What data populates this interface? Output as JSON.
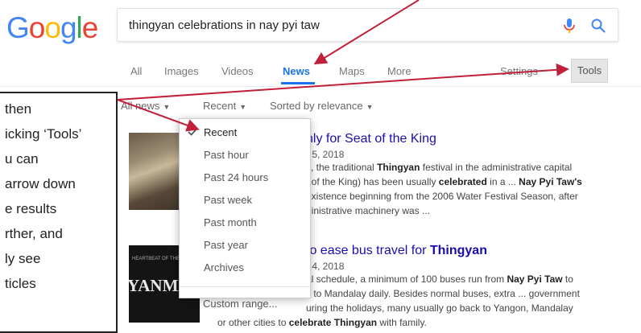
{
  "logo": {
    "letters": [
      "G",
      "o",
      "o",
      "g",
      "l",
      "e"
    ],
    "colors": [
      "#4285F4",
      "#EA4335",
      "#FBBC05",
      "#4285F4",
      "#34A853",
      "#EA4335"
    ]
  },
  "search": {
    "query": "thingyan celebrations in nay pyi taw",
    "icons": [
      "mic-icon",
      "search-icon"
    ]
  },
  "tabs": [
    {
      "label": "All",
      "active": false
    },
    {
      "label": "Images",
      "active": false
    },
    {
      "label": "Videos",
      "active": false
    },
    {
      "label": "News",
      "active": true
    },
    {
      "label": "Maps",
      "active": false
    },
    {
      "label": "More",
      "active": false
    },
    {
      "label": "Settings",
      "active": false
    },
    {
      "label": "Tools",
      "active": false
    }
  ],
  "filters": {
    "all_news": "All news",
    "recent": "Recent",
    "sort": "Sorted by relevance"
  },
  "dropdown": {
    "items": [
      "Recent",
      "Past hour",
      "Past 24 hours",
      "Past week",
      "Past month",
      "Past year",
      "Archives"
    ],
    "selected": "Recent",
    "custom": "Custom range..."
  },
  "results": [
    {
      "title": "nly for Seat of the King",
      "date": "r 5, 2018",
      "snippet": [
        [
          {
            "t": "s, the traditional "
          },
          {
            "t": "Thingyan",
            "b": true
          },
          {
            "t": " festival in the administrative capital"
          }
        ],
        [
          {
            "t": "t of the King) has been usually "
          },
          {
            "t": "celebrated",
            "b": true
          },
          {
            "t": " in a ... "
          },
          {
            "t": "Nay Pyi Taw's",
            "b": true
          }
        ],
        [
          {
            "t": "existence beginning from the 2006 Water Festival Season, after"
          }
        ],
        [
          {
            "t": "ninistrative machinery was ..."
          }
        ]
      ]
    },
    {
      "title_parts": [
        {
          "t": "to ease bus travel for "
        },
        {
          "t": "Thingyan",
          "b": true
        }
      ],
      "date": "r 4, 2018",
      "snippet": [
        [
          {
            "t": "al schedule, a minimum of 100 buses run from "
          },
          {
            "t": "Nay Pyi Taw",
            "b": true
          },
          {
            "t": " to"
          }
        ],
        [
          {
            "t": "s to Mandalay daily. Besides normal buses, extra ... government"
          }
        ],
        [
          {
            "t": "uring the holidays, many usually go back to Yangon, Mandalay"
          }
        ],
        [
          {
            "t": "or other cities to "
          },
          {
            "t": "celebrate Thingyan",
            "b": true
          },
          {
            "t": " with family."
          }
        ]
      ]
    }
  ],
  "thumbnail2": {
    "small_text": "HEARTBEAT OF THE NATION",
    "big_text": "YANMA"
  },
  "callout": {
    "lines": [
      "then",
      "icking ‘Tools’",
      "u can",
      "arrow down",
      "e results",
      "rther, and",
      "ly see",
      "ticles"
    ]
  },
  "annotation_color": "#C0203A"
}
